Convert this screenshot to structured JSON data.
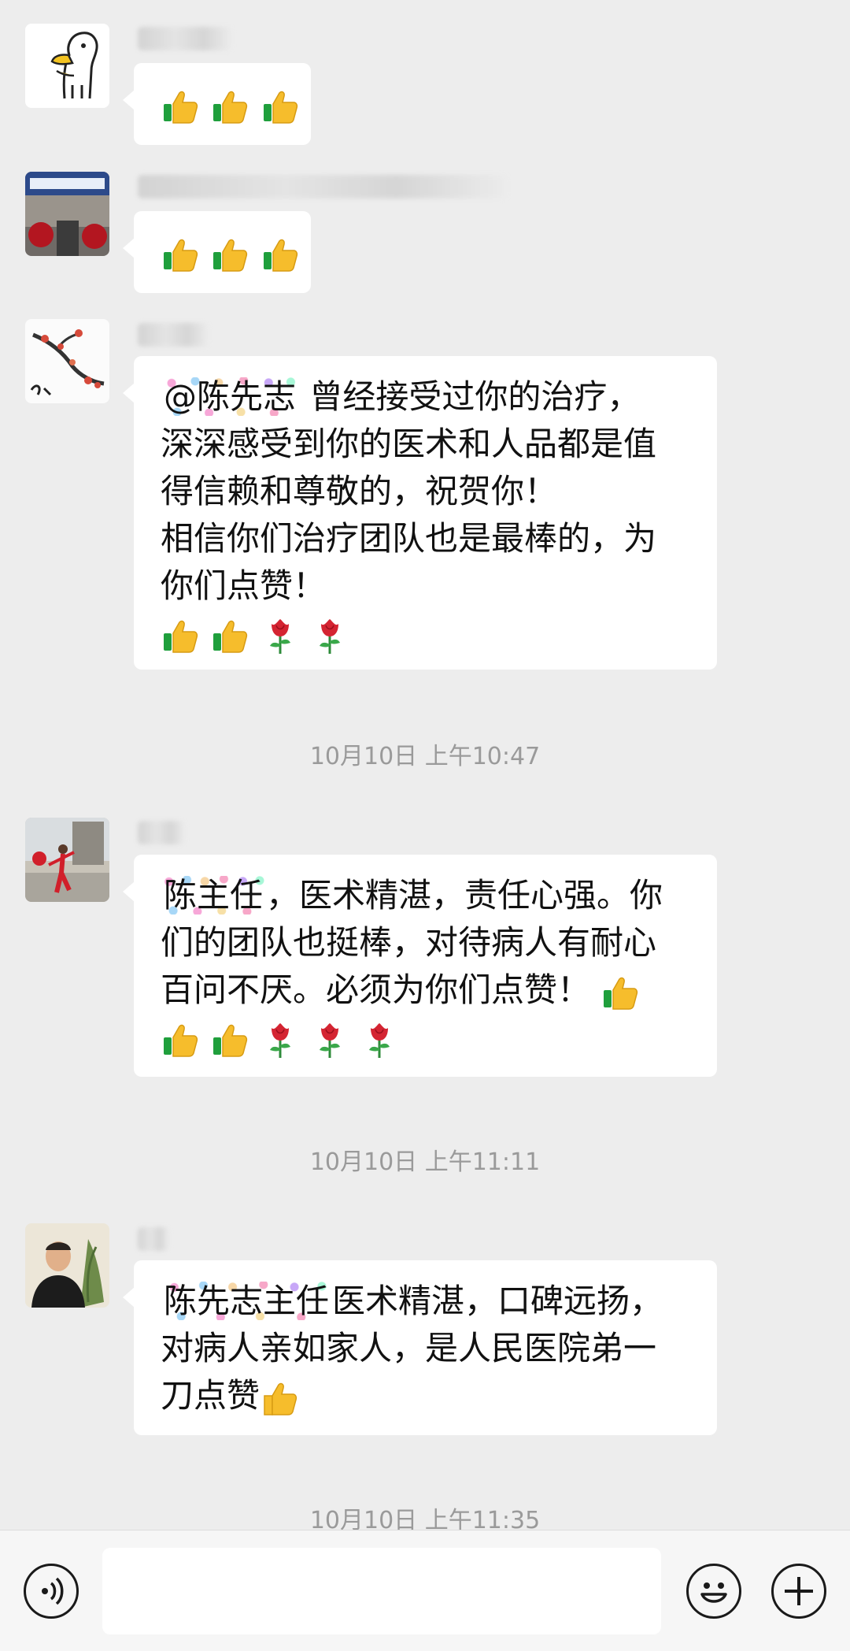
{
  "messages": [
    {
      "emojis": [
        "thumbs-up",
        "thumbs-up",
        "thumbs-up"
      ]
    },
    {
      "emojis": [
        "thumbs-up",
        "thumbs-up",
        "thumbs-up"
      ]
    },
    {
      "mention": "@陈先志",
      "lines": [
        "曾经接受过你的治疗，",
        "深深感受到你的医术和人品都是值",
        "得信赖和尊敬的，祝贺你！",
        "相信你们治疗团队也是最棒的，为",
        "你们点赞！"
      ],
      "emojis": [
        "thumbs-up",
        "thumbs-up",
        "rose",
        "rose"
      ]
    },
    {
      "mention": "陈主任",
      "lines": [
        "，医术精湛，责任心强。你",
        "们的团队也挺棒，对待病人有耐心",
        "百问不厌。必须为你们点赞！"
      ],
      "emojis": [
        "thumbs-up",
        "thumbs-up",
        "thumbs-up",
        "rose",
        "rose",
        "rose"
      ]
    },
    {
      "mention": "陈先志主任",
      "lines": [
        "医术精湛，口碑远扬，",
        "对病人亲如家人，是人民医院弟一",
        "刀点赞"
      ],
      "emojis": [
        "thumbs-up"
      ]
    }
  ],
  "timestamps": [
    "10月10日 上午10:47",
    "10月10日 上午11:11",
    "10月10日 上午11:35"
  ],
  "input_bar": {
    "voice_icon": "voice-icon",
    "emoji_icon": "smiley-icon",
    "more_icon": "plus-icon"
  },
  "colors": {
    "background": "#ededed",
    "bubble": "#ffffff",
    "timestamp": "#9a9a9a"
  }
}
